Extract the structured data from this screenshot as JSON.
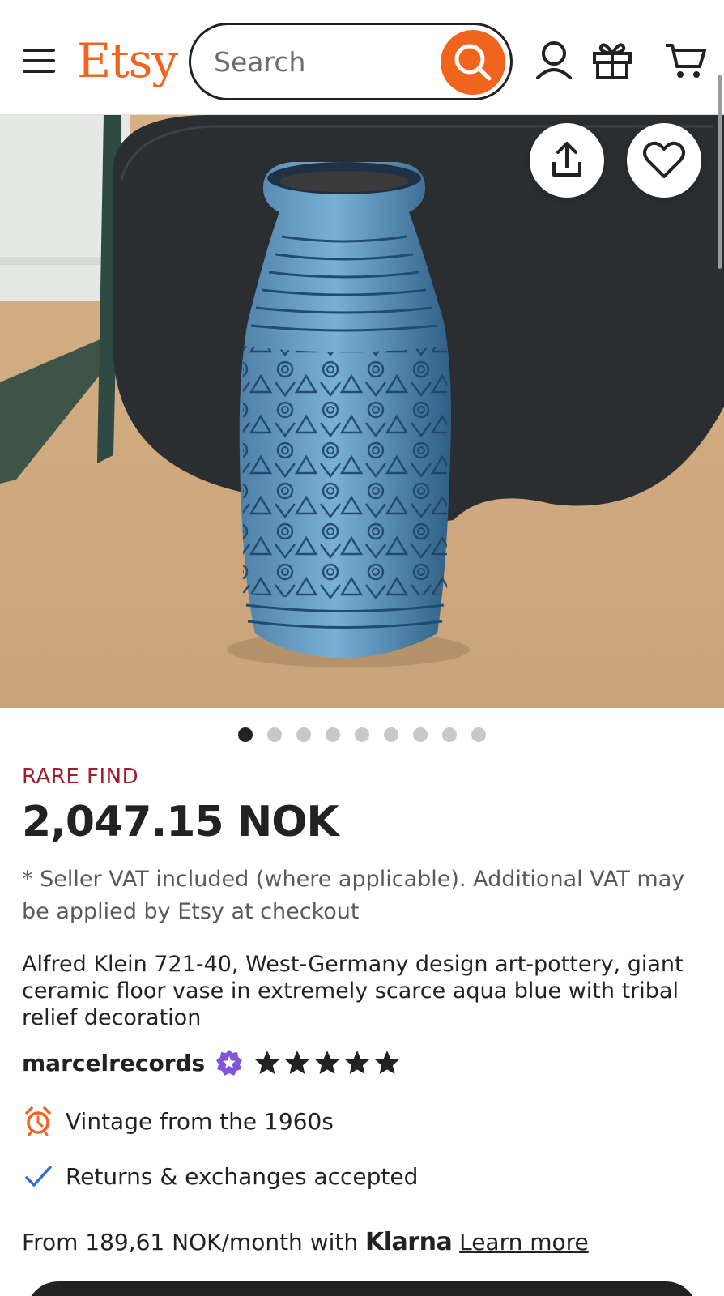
{
  "header": {
    "brand": "Etsy",
    "search_placeholder": "Search",
    "icons": [
      "menu-icon",
      "search-icon",
      "account-icon",
      "gift-icon",
      "cart-icon"
    ]
  },
  "hero": {
    "image_count": 9,
    "active_index": 0,
    "icons": [
      "share-icon",
      "heart-icon"
    ]
  },
  "listing": {
    "badge": "RARE FIND",
    "price": "2,047.15 NOK",
    "vat_note": "* Seller VAT included (where applicable). Additional VAT may be applied by Etsy at checkout",
    "title": "Alfred Klein 721-40, West-Germany design art-pottery, giant ceramic floor vase in extremely scarce aqua blue with tribal relief decoration",
    "seller": "marcelrecords",
    "rating_stars": 5
  },
  "features": [
    {
      "icon": "alarm-clock-icon",
      "text": "Vintage from the 1960s"
    },
    {
      "icon": "checkmark-icon",
      "text": "Returns & exchanges accepted"
    }
  ],
  "klarna": {
    "prefix": "From 189,61 NOK/month with",
    "brand": "Klarna",
    "link": "Learn more"
  },
  "colors": {
    "brand": "#f1641e",
    "rare": "#a61a2e",
    "star_seller": "#7f56d9",
    "check": "#2f6fd1"
  }
}
